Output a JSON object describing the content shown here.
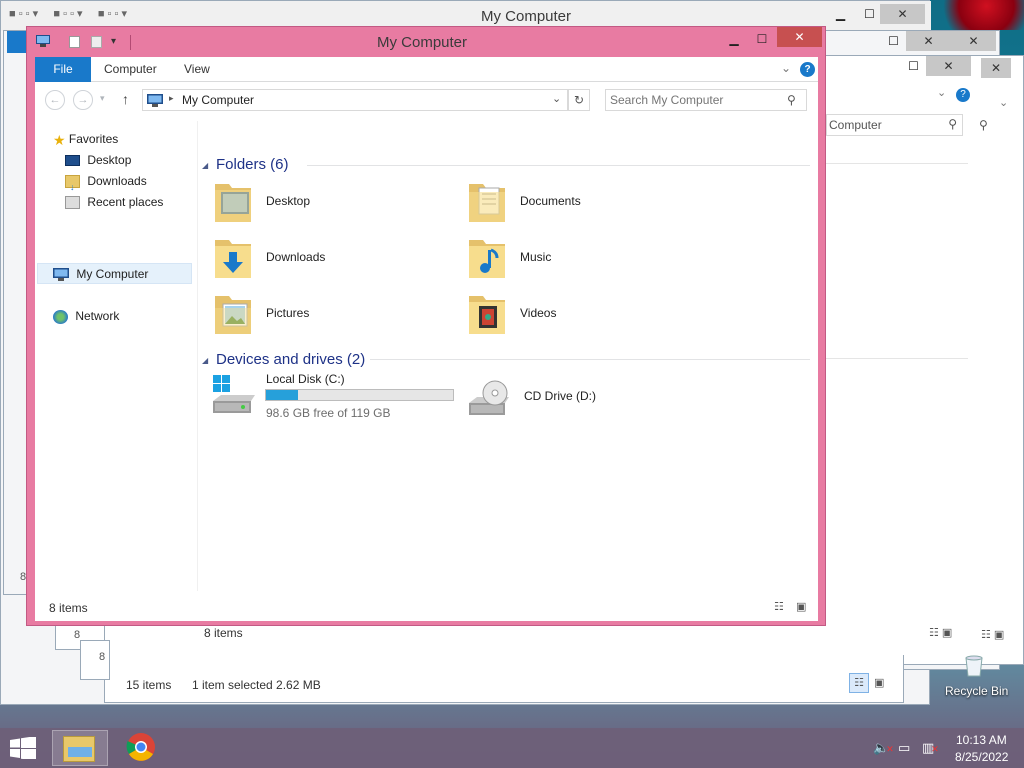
{
  "back_windows": [
    {
      "title": "My Computer",
      "status_items": "15 items",
      "status_selected": "1 item selected  2.62 MB"
    },
    {
      "status_items": "8 items",
      "search_tail": "Computer"
    }
  ],
  "window": {
    "title": "My Computer",
    "tabs": {
      "file": "File",
      "computer": "Computer",
      "view": "View"
    },
    "address": {
      "path": "My Computer"
    },
    "search": {
      "placeholder": "Search My Computer"
    },
    "nav": {
      "favorites": "Favorites",
      "desktop": "Desktop",
      "downloads": "Downloads",
      "recent": "Recent places",
      "my_computer": "My Computer",
      "network": "Network"
    },
    "sections": {
      "folders": "Folders (6)",
      "devices": "Devices and drives (2)"
    },
    "folders": [
      {
        "label": "Desktop",
        "icon": "desktop-folder-icon"
      },
      {
        "label": "Documents",
        "icon": "documents-folder-icon"
      },
      {
        "label": "Downloads",
        "icon": "downloads-folder-icon"
      },
      {
        "label": "Music",
        "icon": "music-folder-icon"
      },
      {
        "label": "Pictures",
        "icon": "pictures-folder-icon"
      },
      {
        "label": "Videos",
        "icon": "videos-folder-icon"
      }
    ],
    "drives": {
      "local": {
        "label": "Local Disk (C:)",
        "free": "98.6 GB free of 119 GB",
        "used_fraction": 0.17
      },
      "cd": {
        "label": "CD Drive (D:)"
      }
    },
    "status": {
      "items": "8 items"
    }
  },
  "desktop": {
    "recycle_bin": "Recycle Bin"
  },
  "taskbar": {
    "time": "10:13 AM",
    "date": "8/25/2022"
  },
  "colors": {
    "accent": "#1979ca",
    "active_border": "#e87ba2",
    "close": "#c75050",
    "capacity_bar": "#26a0da"
  }
}
